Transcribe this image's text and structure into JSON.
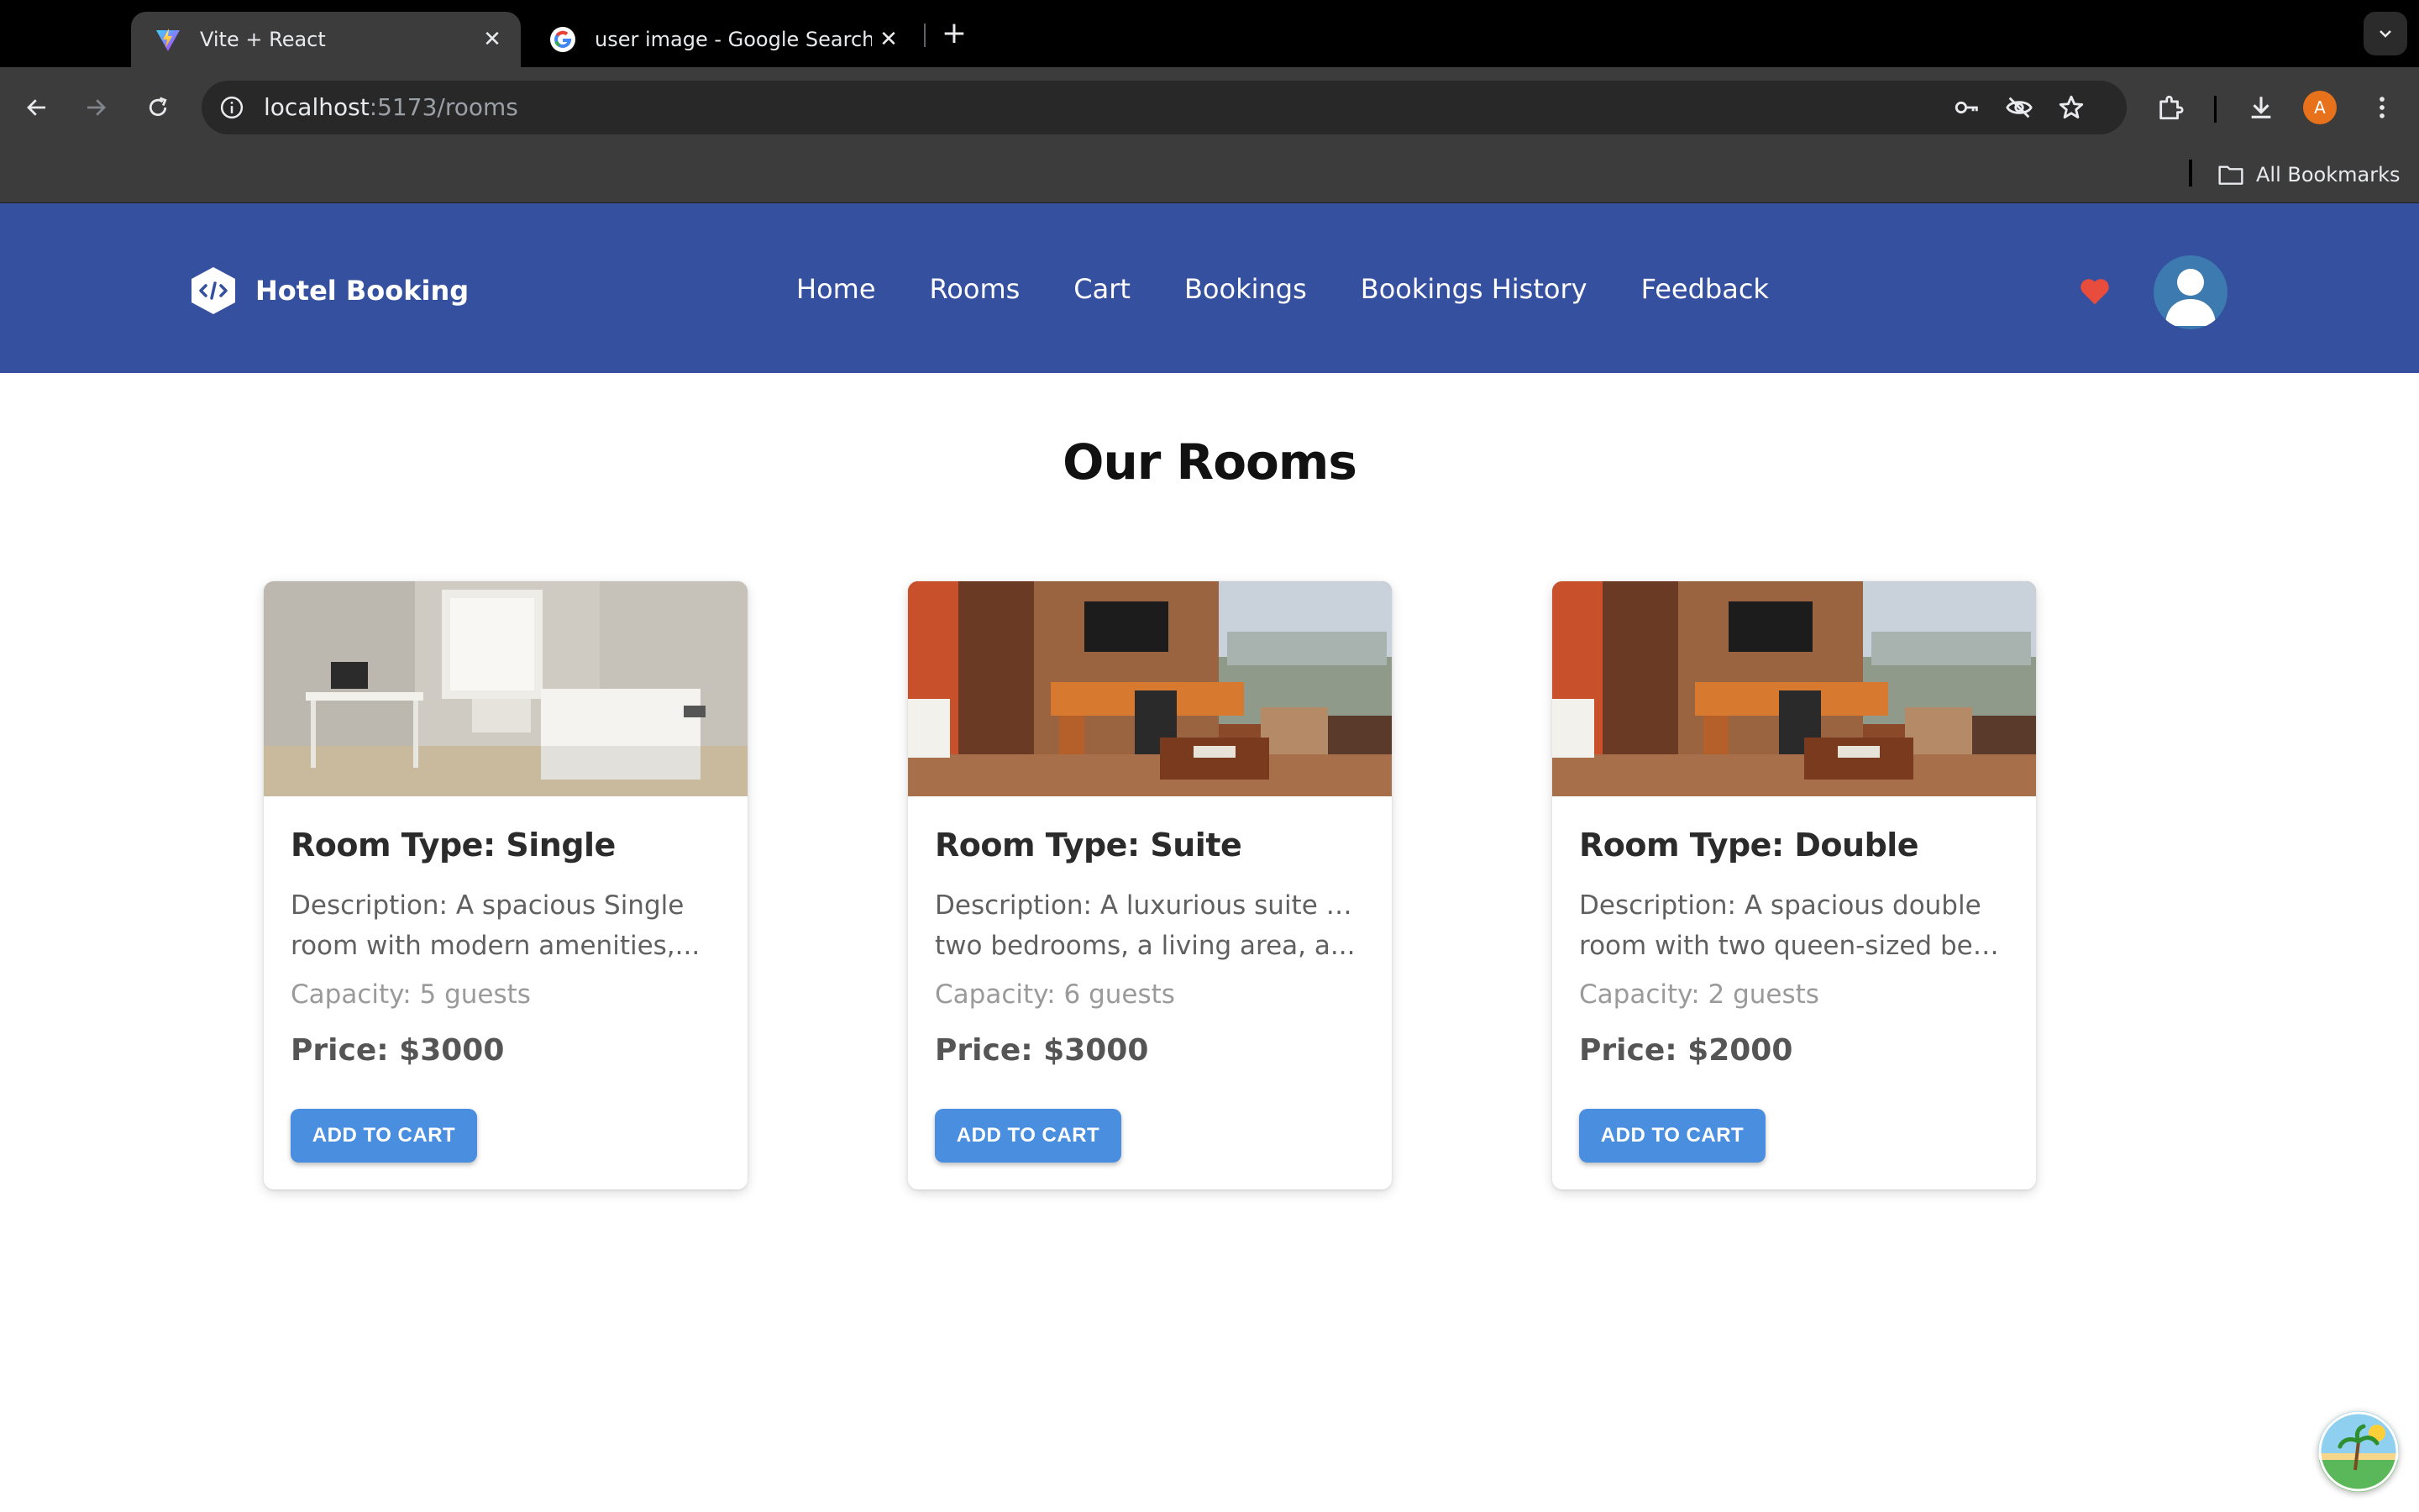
{
  "browser": {
    "tabs": [
      {
        "title": "Vite + React",
        "favicon": "vite-icon",
        "active": true
      },
      {
        "title": "user image - Google Search",
        "favicon": "google-icon",
        "active": false
      }
    ],
    "url_host": "localhost",
    "url_path": ":5173/rooms",
    "bookmarks_label": "All Bookmarks",
    "profile_initial": "A"
  },
  "header": {
    "brand": "Hotel Booking",
    "nav": [
      "Home",
      "Rooms",
      "Cart",
      "Bookings",
      "Bookings History",
      "Feedback"
    ],
    "colors": {
      "header_bg": "#35509e",
      "heart": "#e74c3c",
      "button": "#4a8ee0"
    }
  },
  "page": {
    "title": "Our Rooms",
    "rooms": [
      {
        "type": "Room Type: Single",
        "desc_line1": "Description: A spacious Single",
        "desc_line2": "room with modern amenities,...",
        "capacity": "Capacity: 5 guests",
        "price": "Price: $3000",
        "button": "ADD TO CART"
      },
      {
        "type": "Room Type: Suite",
        "desc_line1": "Description: A luxurious suite with",
        "desc_line2": "two bedrooms, a living area, a...",
        "capacity": "Capacity: 6 guests",
        "price": "Price: $3000",
        "button": "ADD TO CART"
      },
      {
        "type": "Room Type: Double",
        "desc_line1": "Description: A spacious double",
        "desc_line2": "room with two queen-sized beds...",
        "capacity": "Capacity: 2 guests",
        "price": "Price: $2000",
        "button": "ADD TO CART"
      }
    ]
  }
}
